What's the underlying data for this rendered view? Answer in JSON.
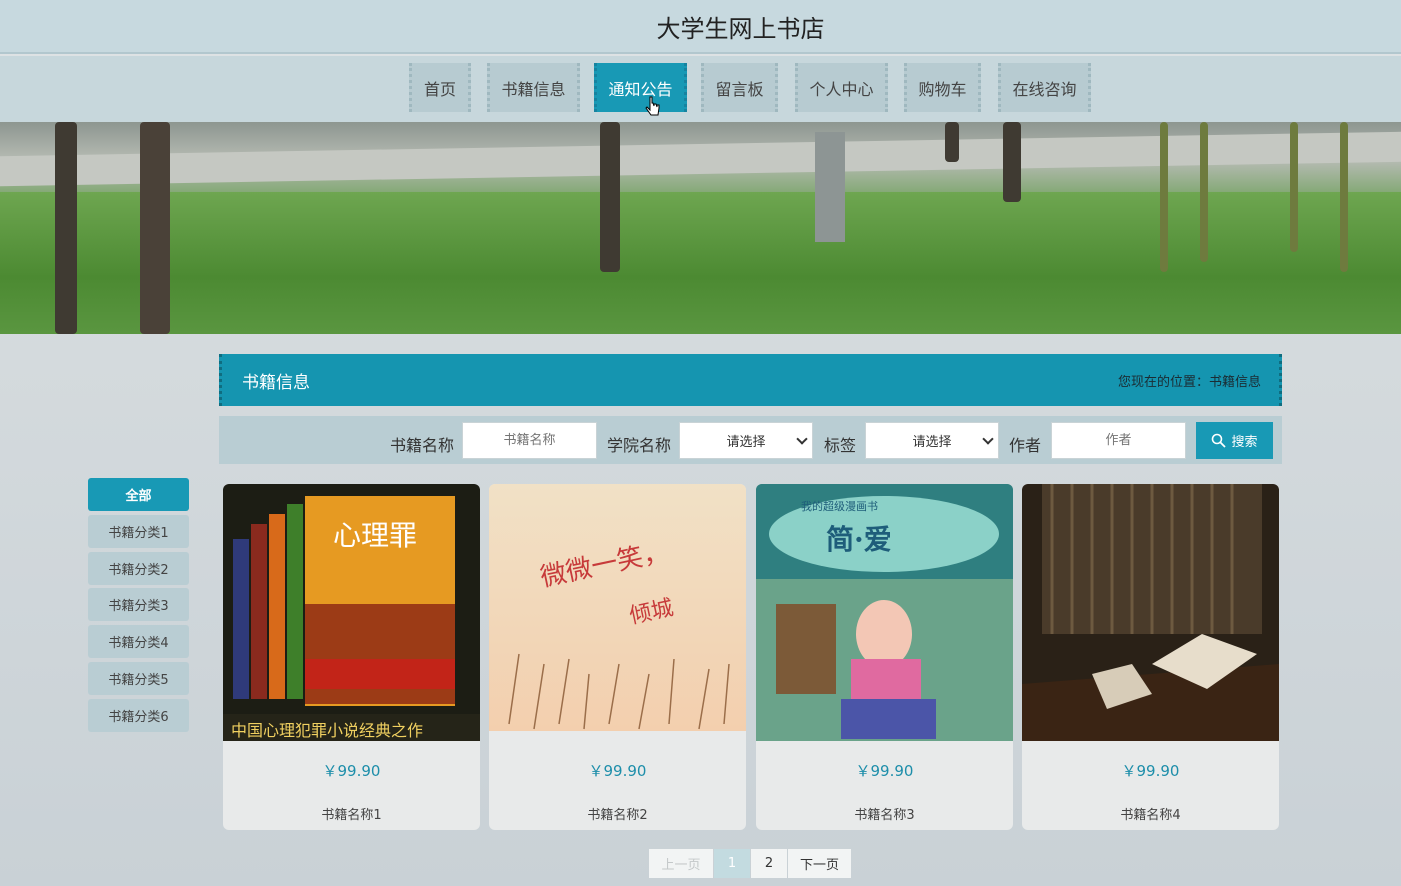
{
  "site_title": "大学生网上书店",
  "nav": {
    "items": [
      {
        "label": "首页"
      },
      {
        "label": "书籍信息"
      },
      {
        "label": "通知公告"
      },
      {
        "label": "留言板"
      },
      {
        "label": "个人中心"
      },
      {
        "label": "购物车"
      },
      {
        "label": "在线咨询"
      }
    ],
    "active": "通知公告"
  },
  "panel": {
    "title": "书籍信息",
    "breadcrumb": "您现在的位置：书籍信息"
  },
  "search": {
    "name_label": "书籍名称",
    "name_placeholder": "书籍名称",
    "college_label": "学院名称",
    "college_value": "请选择",
    "tag_label": "标签",
    "tag_value": "请选择",
    "author_label": "作者",
    "author_placeholder": "作者",
    "button_label": "搜索"
  },
  "categories": [
    "全部",
    "书籍分类1",
    "书籍分类2",
    "书籍分类3",
    "书籍分类4",
    "书籍分类5",
    "书籍分类6"
  ],
  "books": [
    {
      "price": "￥99.90",
      "name": "书籍名称1",
      "cover_title": "心理罪",
      "cover_caption": "中国心理犯罪小说经典之作"
    },
    {
      "price": "￥99.90",
      "name": "书籍名称2",
      "cover_title": "微微一笑，",
      "cover_caption": "倾城"
    },
    {
      "price": "￥99.90",
      "name": "书籍名称3",
      "cover_title": "简·爱",
      "cover_caption": "我的超级漫画书"
    },
    {
      "price": "￥99.90",
      "name": "书籍名称4",
      "cover_title": "",
      "cover_caption": ""
    }
  ],
  "pager": {
    "prev": "上一页",
    "pages": [
      "1",
      "2"
    ],
    "next": "下一页"
  },
  "colors": {
    "accent": "#1899b5",
    "nav_bg": "#b7cbd1",
    "price": "#1d8eaa"
  }
}
